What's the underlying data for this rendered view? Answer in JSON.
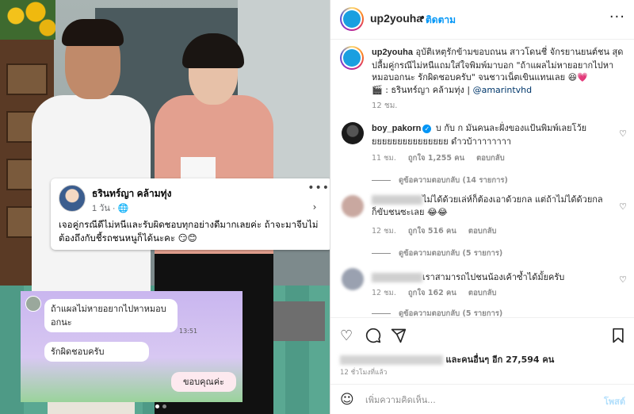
{
  "photo": {
    "fb_post": {
      "name": "ธรินทร์ญา คล้ามทุ่ง",
      "time": "1 วัน · ",
      "text": "เจอคู่กรณีดีไม่หนีและรับผิดชอบทุกอย่างดีมากเลยค่ะ  ถ้าจะมาจีบไม่ต้องถึงกับชี้รถชนหนูก็ได้นะคะ 😏😊"
    },
    "chat": {
      "bubble1": "ถ้าแผลไม่หายอยากไปหาหมอบอกนะ",
      "bubble2": "รักผิดชอบครับ",
      "bubble3": "ขอบคุณค่ะ",
      "time": "13:51"
    },
    "next_arrow": "›"
  },
  "header": {
    "username": "up2youha",
    "dot": "•",
    "follow": "ติดตาม",
    "more": "···"
  },
  "caption": {
    "username": "up2youha",
    "text": " อุบัติเหตุรักข้ามขอบถนน สาวโดนชี่ จักรยานยนต์ชน สุดปลื้มคู่กรณีไม่หนีแถมใส่ใจพิมพ์มาบอก \"ถ้าแผลไม่หายอยากไปหาหมอบอกนะ รักผิดชอบครับ\" จนชาวเน็ตเขินแทนเลย 😆💗",
    "credit": "🎬 : ธรินทร์ญา คล้ามทุ่ง | ",
    "mention": "@amarintvhd",
    "time": "12 ชม."
  },
  "comments": [
    {
      "username": "boy_pakorn",
      "verified": "✓",
      "text": " บ กับ ก มันคนละฝั่งของแป้นพิมพ์เลยโว้ยยยยยยยยยยยยยยยย ดำวบ้าาาาาาาา",
      "time": "11 ชม.",
      "likes": "ถูกใจ 1,255 คน",
      "reply": "ตอบกลับ",
      "view_replies": "ดูข้อความตอบกลับ (14 รายการ)"
    },
    {
      "username": "",
      "text": "ไม่ได้ด้วยเล่ห์ก็ต้องเอาด้วยกล แต่ถ้าไม่ได้ด้วยกล ก็ขับชนซะเลย 😂😂",
      "time": "12 ชม.",
      "likes": "ถูกใจ 516 คน",
      "reply": "ตอบกลับ",
      "view_replies": "ดูข้อความตอบกลับ (5 รายการ)"
    },
    {
      "username": "",
      "text": "เราสามารถไปชนน้องเค้าซ้ำได้มั้ยครับ",
      "time": "12 ชม.",
      "likes": "ถูกใจ 162 คน",
      "reply": "ตอบกลับ",
      "view_replies": "ดูข้อความตอบกลับ (5 รายการ)"
    }
  ],
  "likes": {
    "text": "และคนอื่นๆ อีก 27,594 คน"
  },
  "post_time": "12 ชั่วโมงที่แล้ว",
  "add_comment": {
    "placeholder": "เพิ่มความคิดเห็น...",
    "post": "โพสต์"
  },
  "colors": {
    "link": "#0095f6",
    "mention": "#00376b",
    "muted": "#8e8e8e"
  }
}
